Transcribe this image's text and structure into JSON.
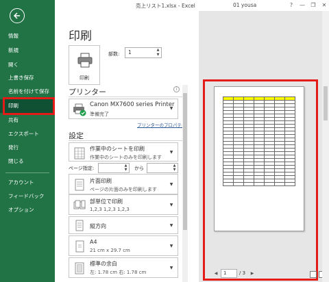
{
  "titlebar": {
    "title": "売上リスト1.xlsx  -  Excel",
    "user": "01 yousa",
    "help": "?",
    "minimize": "—",
    "restore": "❐",
    "close": "✕"
  },
  "sidebar": {
    "items": [
      {
        "label": "情報"
      },
      {
        "label": "新規"
      },
      {
        "label": "開く"
      },
      {
        "label": "上書き保存"
      },
      {
        "label": "名前を付けて保存"
      },
      {
        "label": "印刷"
      },
      {
        "label": "共有"
      },
      {
        "label": "エクスポート"
      },
      {
        "label": "発行"
      },
      {
        "label": "閉じる"
      },
      {
        "label": "アカウント"
      },
      {
        "label": "フィードバック"
      },
      {
        "label": "オプション"
      }
    ],
    "active_index": 5
  },
  "print": {
    "title": "印刷",
    "button_label": "印刷",
    "copies_label": "部数:",
    "copies_value": "1"
  },
  "printer": {
    "heading": "プリンター",
    "name": "Canon MX7600 series Printer",
    "status": "準備完了",
    "properties_link": "プリンターのプロパティ",
    "info_icon": "i"
  },
  "settings": {
    "heading": "設定",
    "scope_main": "作業中のシートを印刷",
    "scope_sub": "作業中のシートのみを印刷します",
    "pages_label": "ページ指定:",
    "pages_to": "から",
    "sides_main": "片面印刷",
    "sides_sub": "ページの片面のみを印刷します",
    "collate_main": "部単位で印刷",
    "collate_sub": "1,2,3    1,2,3    1,2,3",
    "orientation_main": "縦方向",
    "paper_main": "A4",
    "paper_sub": "21 cm x 29.7 cm",
    "margin_main": "標準の余白",
    "margin_sub": "左:  1.78 cm    右:  1.78 cm"
  },
  "preview": {
    "current_page": "1",
    "total_pages": "/ 3"
  },
  "colors": {
    "sidebar_bg": "#217346",
    "sidebar_active": "#0f5132",
    "highlight": "#e41b17",
    "table_header": "#ffff00"
  }
}
